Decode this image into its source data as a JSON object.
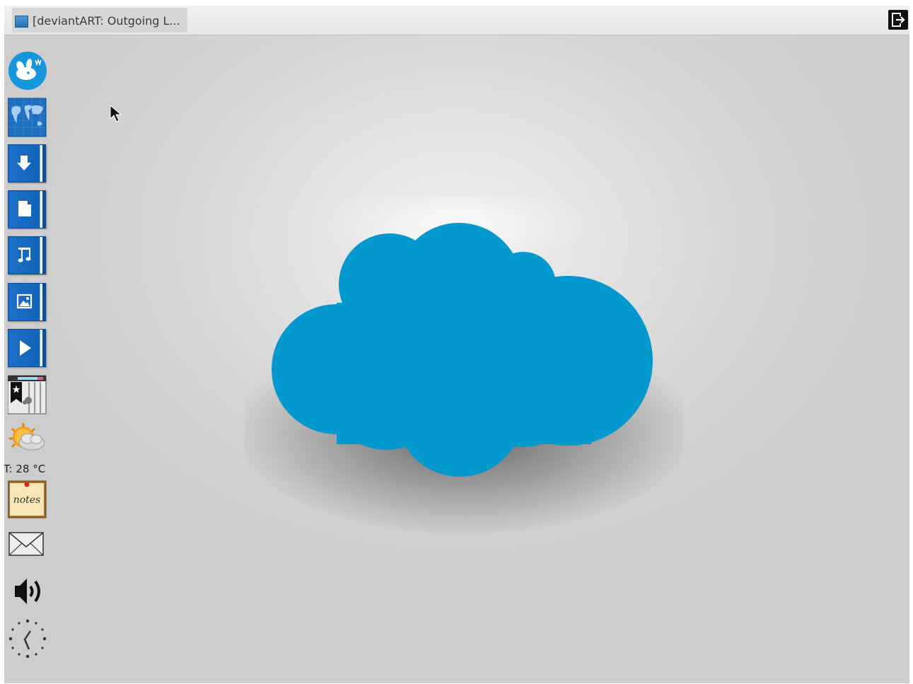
{
  "taskbar": {
    "window_title": "[deviantART: Outgoing L...",
    "window_icon": "map-icon",
    "logout_icon": "logout-icon"
  },
  "dock": {
    "items": [
      {
        "name": "launcher",
        "icon": "xfce-mouse-icon"
      },
      {
        "name": "maps",
        "icon": "world-map-icon"
      },
      {
        "name": "downloads",
        "icon": "download-folder-icon"
      },
      {
        "name": "documents",
        "icon": "documents-folder-icon"
      },
      {
        "name": "music",
        "icon": "music-folder-icon"
      },
      {
        "name": "pictures",
        "icon": "pictures-folder-icon"
      },
      {
        "name": "videos",
        "icon": "videos-folder-icon"
      },
      {
        "name": "bookmarks",
        "icon": "bookmarks-icon"
      },
      {
        "name": "weather",
        "icon": "weather-icon"
      },
      {
        "name": "notes",
        "icon": "notes-icon"
      },
      {
        "name": "mail",
        "icon": "mail-icon"
      },
      {
        "name": "volume",
        "icon": "volume-icon"
      },
      {
        "name": "clock",
        "icon": "clock-icon"
      }
    ],
    "weather_temp": "T: 28 °C",
    "notes_label": "notes"
  },
  "wallpaper": {
    "cloud_color": "#0399ce",
    "background_color": "#d9d9d9"
  }
}
